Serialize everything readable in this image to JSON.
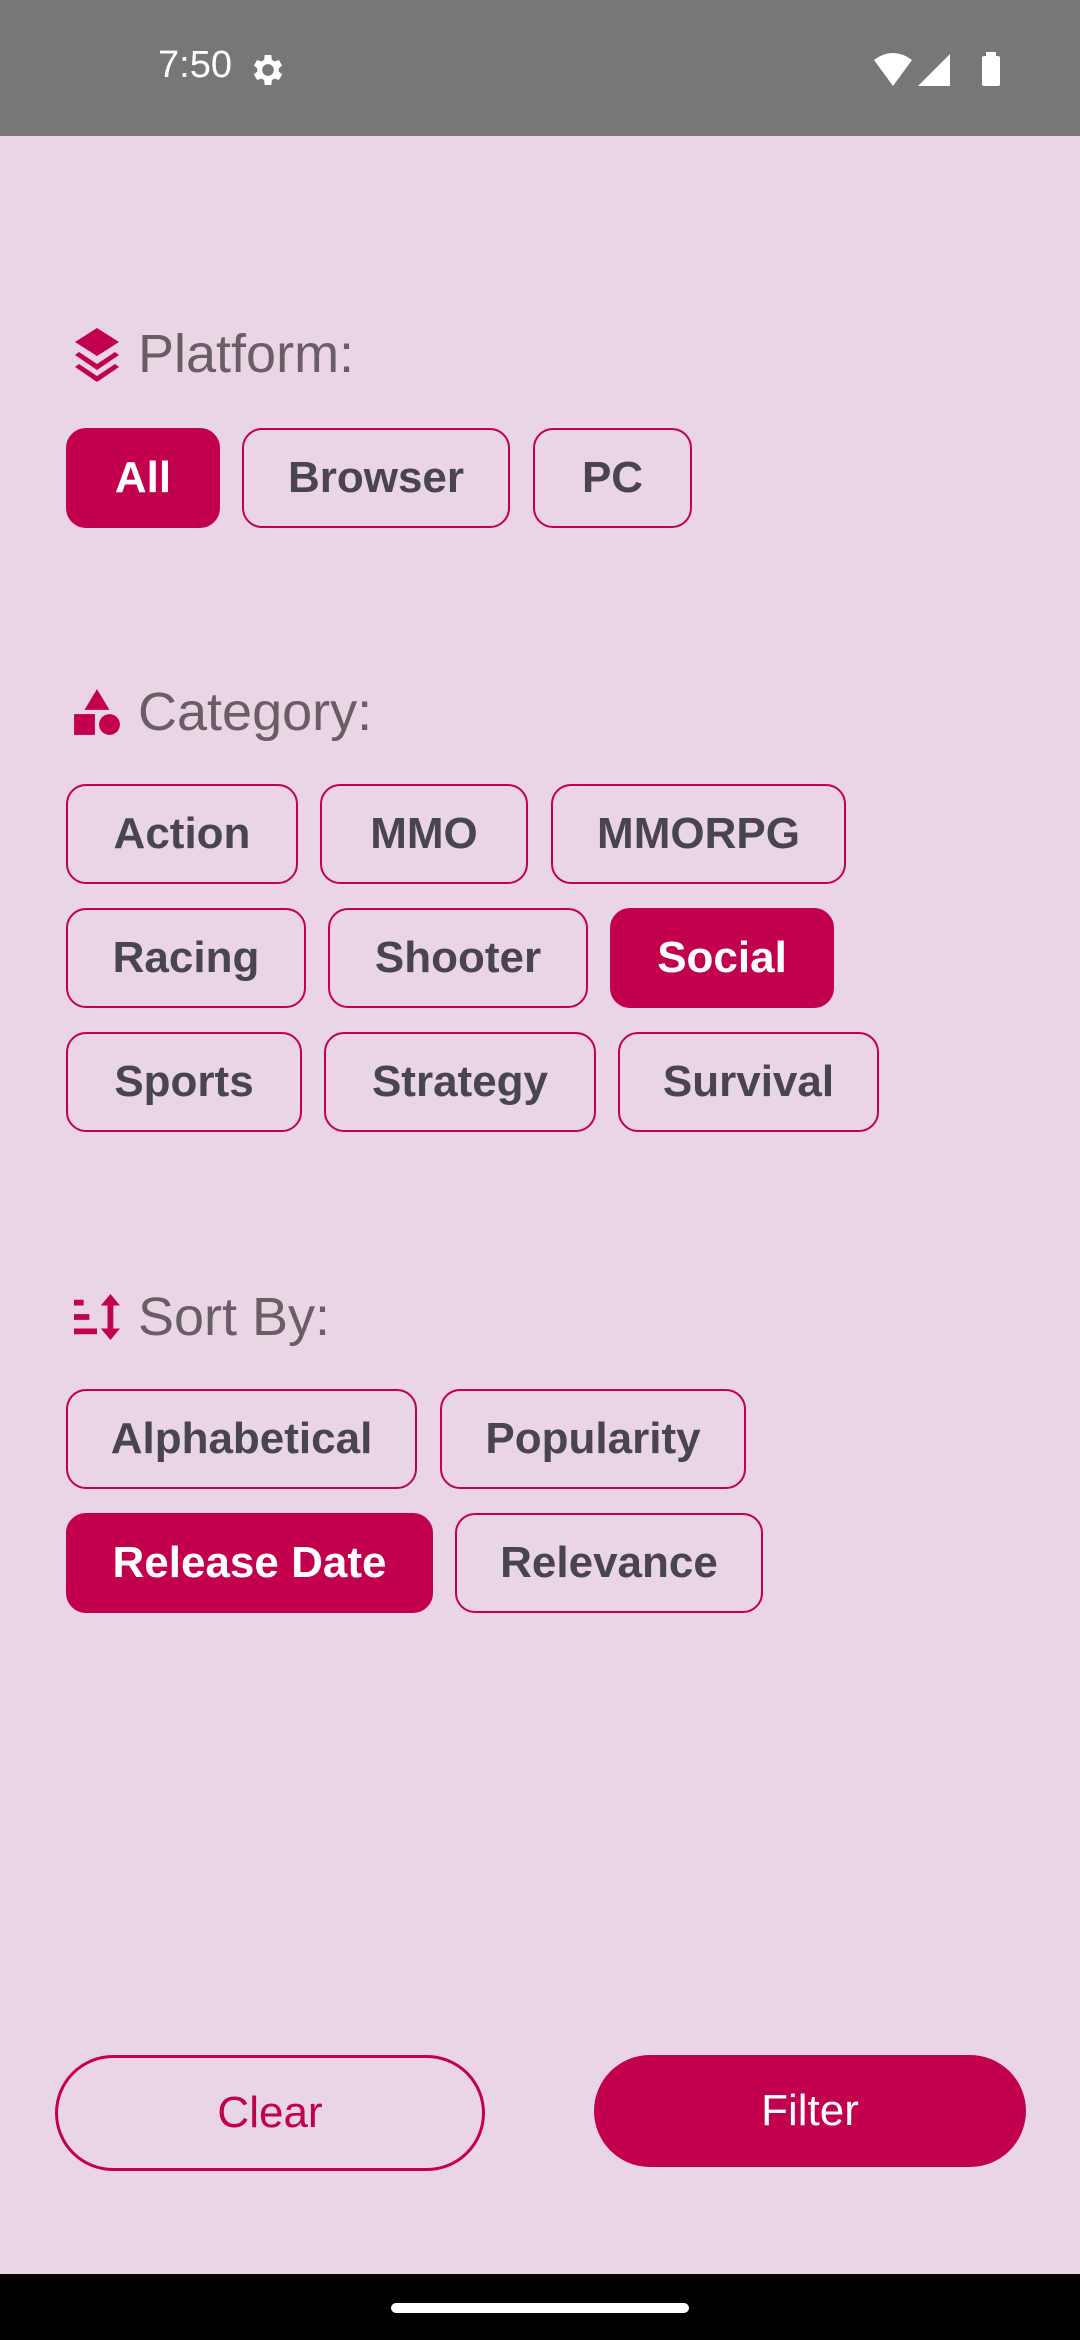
{
  "status_bar": {
    "time": "7:50"
  },
  "platform": {
    "title": "Platform:",
    "chips": [
      {
        "label": "All",
        "selected": true
      },
      {
        "label": "Browser",
        "selected": false
      },
      {
        "label": "PC",
        "selected": false
      }
    ]
  },
  "category": {
    "title": "Category:",
    "chips": [
      {
        "label": "Action",
        "selected": false
      },
      {
        "label": "MMO",
        "selected": false
      },
      {
        "label": "MMORPG",
        "selected": false
      },
      {
        "label": "Racing",
        "selected": false
      },
      {
        "label": "Shooter",
        "selected": false
      },
      {
        "label": "Social",
        "selected": true
      },
      {
        "label": "Sports",
        "selected": false
      },
      {
        "label": "Strategy",
        "selected": false
      },
      {
        "label": "Survival",
        "selected": false
      }
    ]
  },
  "sort": {
    "title": "Sort By:",
    "chips": [
      {
        "label": "Alphabetical",
        "selected": false
      },
      {
        "label": "Popularity",
        "selected": false
      },
      {
        "label": "Release Date",
        "selected": true
      },
      {
        "label": "Relevance",
        "selected": false
      }
    ]
  },
  "actions": {
    "clear_label": "Clear",
    "filter_label": "Filter"
  },
  "colors": {
    "accent": "#C2004D",
    "background": "#EAD5E4",
    "status_bar": "#777777"
  }
}
